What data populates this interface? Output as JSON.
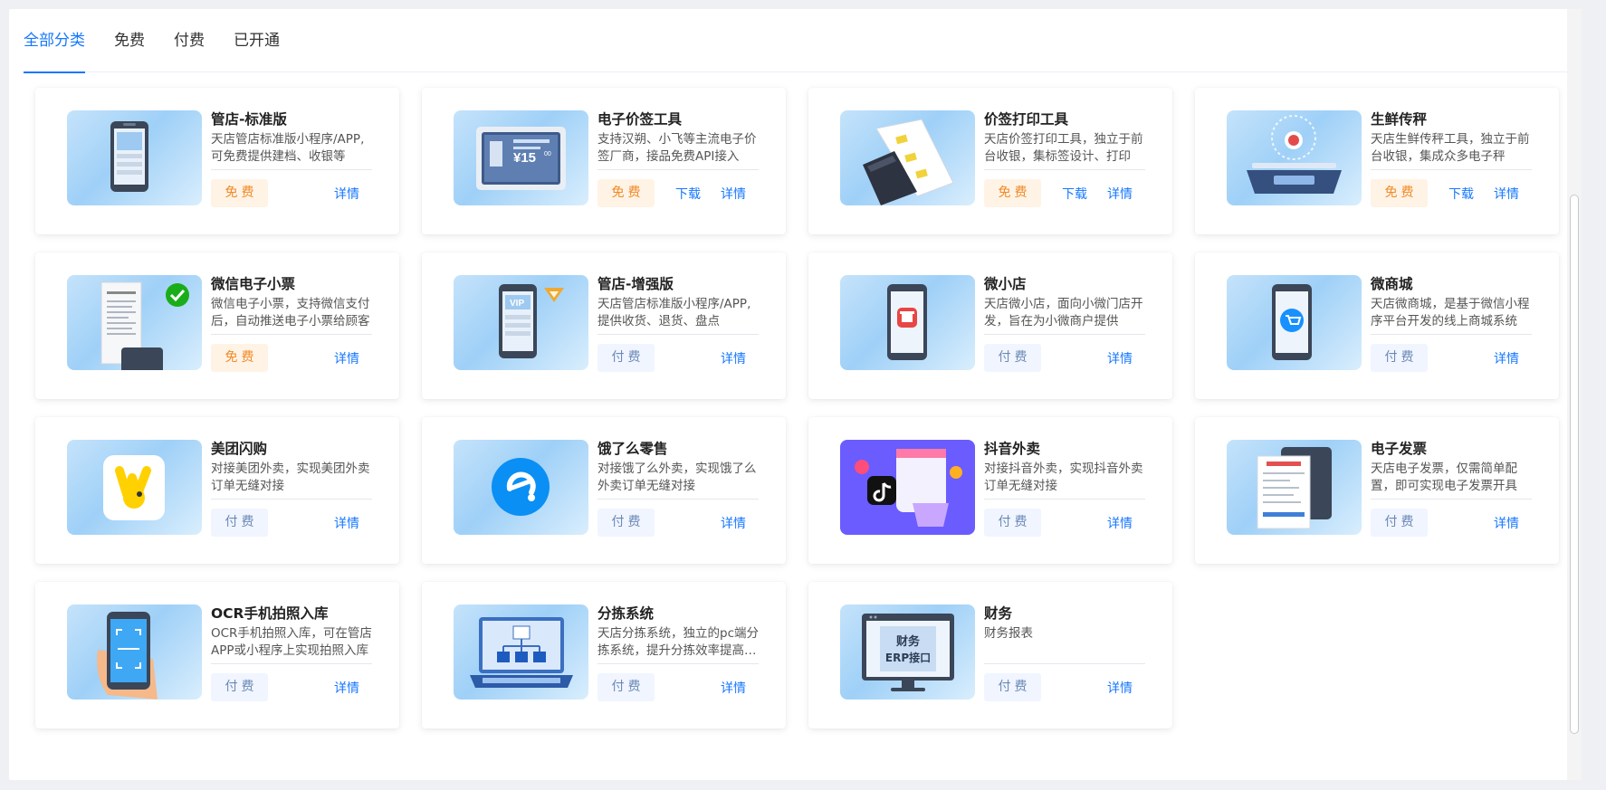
{
  "tabs": [
    {
      "label": "全部分类",
      "active": true
    },
    {
      "label": "免费",
      "active": false
    },
    {
      "label": "付费",
      "active": false
    },
    {
      "label": "已开通",
      "active": false
    }
  ],
  "labels": {
    "download": "下载",
    "details": "详情"
  },
  "price_labels": {
    "free": "免费",
    "paid": "付费"
  },
  "colors": {
    "accent": "#1677ff",
    "free": "#f08a24",
    "paid": "#6b89b5"
  },
  "apps": [
    {
      "title": "管店-标准版",
      "desc": "天店管店标准版小程序/APP,可免费提供建档、收银等",
      "price": "免费",
      "pricing": "free",
      "download": false,
      "icon": "phone-standard-icon"
    },
    {
      "title": "电子价签工具",
      "desc": "支持汉朔、小飞等主流电子价签厂商，接品免费API接入",
      "price": "免费",
      "pricing": "free",
      "download": true,
      "icon": "e-price-tag-icon"
    },
    {
      "title": "价签打印工具",
      "desc": "天店价签打印工具，独立于前台收银，集标签设计、打印",
      "price": "免费",
      "pricing": "free",
      "download": true,
      "icon": "label-printer-icon"
    },
    {
      "title": "生鲜传秤",
      "desc": "天店生鲜传秤工具，独立于前台收银，集成众多电子秤",
      "price": "免费",
      "pricing": "free",
      "download": true,
      "icon": "scale-icon"
    },
    {
      "title": "微信电子小票",
      "desc": "微信电子小票，支持微信支付后，自动推送电子小票给顾客",
      "price": "免费",
      "pricing": "free",
      "download": false,
      "icon": "wechat-receipt-icon"
    },
    {
      "title": "管店-增强版",
      "desc": "天店管店标准版小程序/APP,提供收货、退货、盘点",
      "price": "付费",
      "pricing": "paid",
      "download": false,
      "icon": "phone-vip-icon"
    },
    {
      "title": "微小店",
      "desc": "天店微小店，面向小微门店开发，旨在为小微商户提供",
      "price": "付费",
      "pricing": "paid",
      "download": false,
      "icon": "mini-shop-icon"
    },
    {
      "title": "微商城",
      "desc": "天店微商城，是基于微信小程序平台开发的线上商城系统",
      "price": "付费",
      "pricing": "paid",
      "download": false,
      "icon": "wechat-mall-icon"
    },
    {
      "title": "美团闪购",
      "desc": "对接美团外卖，实现美团外卖订单无缝对接",
      "price": "付费",
      "pricing": "paid",
      "download": false,
      "icon": "meituan-icon"
    },
    {
      "title": "饿了么零售",
      "desc": "对接饿了么外卖，实现饿了么外卖订单无缝对接",
      "price": "付费",
      "pricing": "paid",
      "download": false,
      "icon": "eleme-icon"
    },
    {
      "title": "抖音外卖",
      "desc": "对接抖音外卖，实现抖音外卖订单无缝对接",
      "price": "付费",
      "pricing": "paid",
      "download": false,
      "icon": "douyin-icon"
    },
    {
      "title": "电子发票",
      "desc": "天店电子发票，仅需简单配置，即可实现电子发票开具",
      "price": "付费",
      "pricing": "paid",
      "download": false,
      "icon": "e-invoice-icon"
    },
    {
      "title": "OCR手机拍照入库",
      "desc": "OCR手机拍照入库，可在管店APP或小程序上实现拍照入库",
      "price": "付费",
      "pricing": "paid",
      "download": false,
      "icon": "ocr-scan-icon"
    },
    {
      "title": "分拣系统",
      "desc": "天店分拣系统，独立的pc端分拣系统，提升分拣效率提高准确",
      "price": "付费",
      "pricing": "paid",
      "download": false,
      "icon": "sorting-laptop-icon"
    },
    {
      "title": "财务",
      "desc": "财务报表",
      "price": "付费",
      "pricing": "paid",
      "download": false,
      "icon": "finance-erp-icon",
      "thumb_text": [
        "财务",
        "ERP接口"
      ]
    }
  ]
}
